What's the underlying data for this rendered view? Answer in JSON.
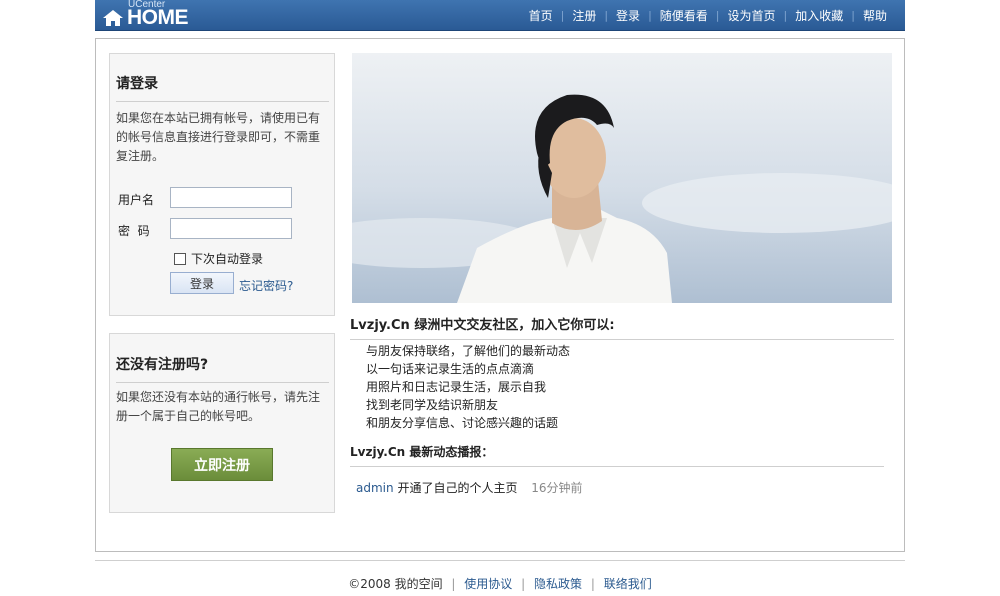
{
  "header": {
    "logo_top": "UCenter",
    "logo_main": "HOME",
    "nav": [
      "首页",
      "注册",
      "登录",
      "随便看看",
      "设为首页",
      "加入收藏",
      "帮助"
    ]
  },
  "login": {
    "title": "请登录",
    "description": "如果您在本站已拥有帐号，请使用已有的帐号信息直接进行登录即可，不需重复注册。",
    "username_label": "用户名",
    "password_label": "密  码",
    "username_value": "",
    "password_value": "",
    "remember_label": "下次自动登录",
    "remember_checked": false,
    "submit_label": "登录",
    "forgot_label": "忘记密码?"
  },
  "register": {
    "title": "还没有注册吗?",
    "description": "如果您还没有本站的通行帐号，请先注册一个属于自己的帐号吧。",
    "button_label": "立即注册"
  },
  "intro": {
    "title": "Lvzjy.Cn 绿洲中文交友社区，加入它你可以:",
    "features": [
      "与朋友保持联络，了解他们的最新动态",
      "以一句话来记录生活的点点滴滴",
      "用照片和日志记录生活，展示自我",
      "找到老同学及结识新朋友",
      "和朋友分享信息、讨论感兴趣的话题"
    ]
  },
  "feed": {
    "title": "Lvzjy.Cn 最新动态播报：",
    "items": [
      {
        "user": "admin",
        "action": "开通了自己的个人主页",
        "time": "16分钟前"
      }
    ]
  },
  "footer": {
    "copyright": "©2008 我的空间",
    "links": [
      "使用协议",
      "隐私政策",
      "联络我们"
    ]
  },
  "colors": {
    "header_bar": "#2f63a1",
    "link": "#2b5a8f",
    "register_button": "#6f9140"
  }
}
